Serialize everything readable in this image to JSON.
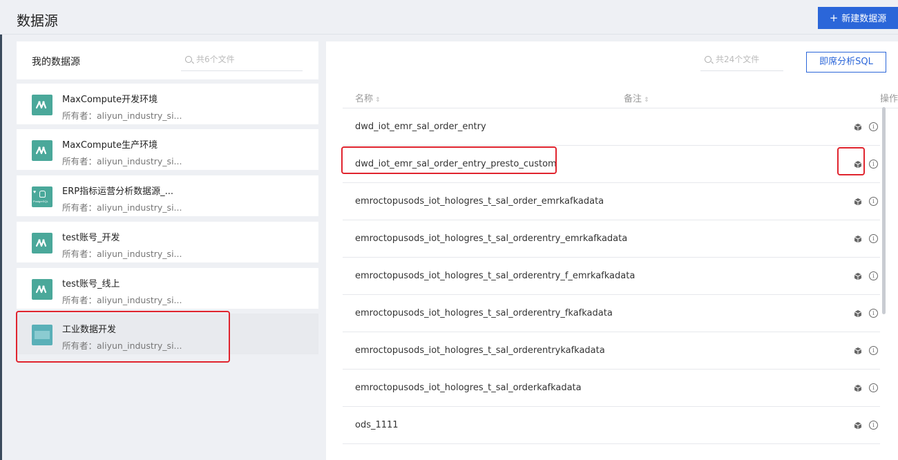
{
  "header": {
    "title": "数据源",
    "new_button_label": "新建数据源"
  },
  "left": {
    "title": "我的数据源",
    "search_placeholder": "共6个文件",
    "items": [
      {
        "name": "MaxCompute开发环境",
        "owner": "所有者：aliyun_industry_si...",
        "icon": "maxcompute-icon"
      },
      {
        "name": "MaxCompute生产环境",
        "owner": "所有者：aliyun_industry_si...",
        "icon": "maxcompute-icon"
      },
      {
        "name": "ERP指标运营分析数据源_...",
        "owner": "所有者：aliyun_industry_si...",
        "icon": "postgresql-icon"
      },
      {
        "name": "test账号_开发",
        "owner": "所有者：aliyun_industry_si...",
        "icon": "maxcompute-icon"
      },
      {
        "name": "test账号_线上",
        "owner": "所有者：aliyun_industry_si...",
        "icon": "maxcompute-icon"
      },
      {
        "name": "工业数据开发",
        "owner": "所有者：aliyun_industry_si...",
        "icon": "industry-datasource-icon"
      }
    ]
  },
  "right": {
    "search_placeholder": "共24个文件",
    "sql_button_label": "即席分析SQL",
    "columns": {
      "name": "名称",
      "note": "备注",
      "ops": "操作"
    },
    "rows": [
      {
        "name": "dwd_iot_emr_sal_order_entry"
      },
      {
        "name": "dwd_iot_emr_sal_order_entry_presto_custom"
      },
      {
        "name": "emroctopusods_iot_hologres_t_sal_order_emrkafkadata"
      },
      {
        "name": "emroctopusods_iot_hologres_t_sal_orderentry_emrkafkadata"
      },
      {
        "name": "emroctopusods_iot_hologres_t_sal_orderentry_f_emrkafkadata"
      },
      {
        "name": "emroctopusods_iot_hologres_t_sal_orderentry_fkafkadata"
      },
      {
        "name": "emroctopusods_iot_hologres_t_sal_orderentrykafkadata"
      },
      {
        "name": "emroctopusods_iot_hologres_t_sal_orderkafkadata"
      },
      {
        "name": "ods_1111"
      }
    ]
  },
  "colors": {
    "accent": "#2b66d9",
    "highlight": "#e0242e",
    "icon_teal": "#4aa89a"
  }
}
